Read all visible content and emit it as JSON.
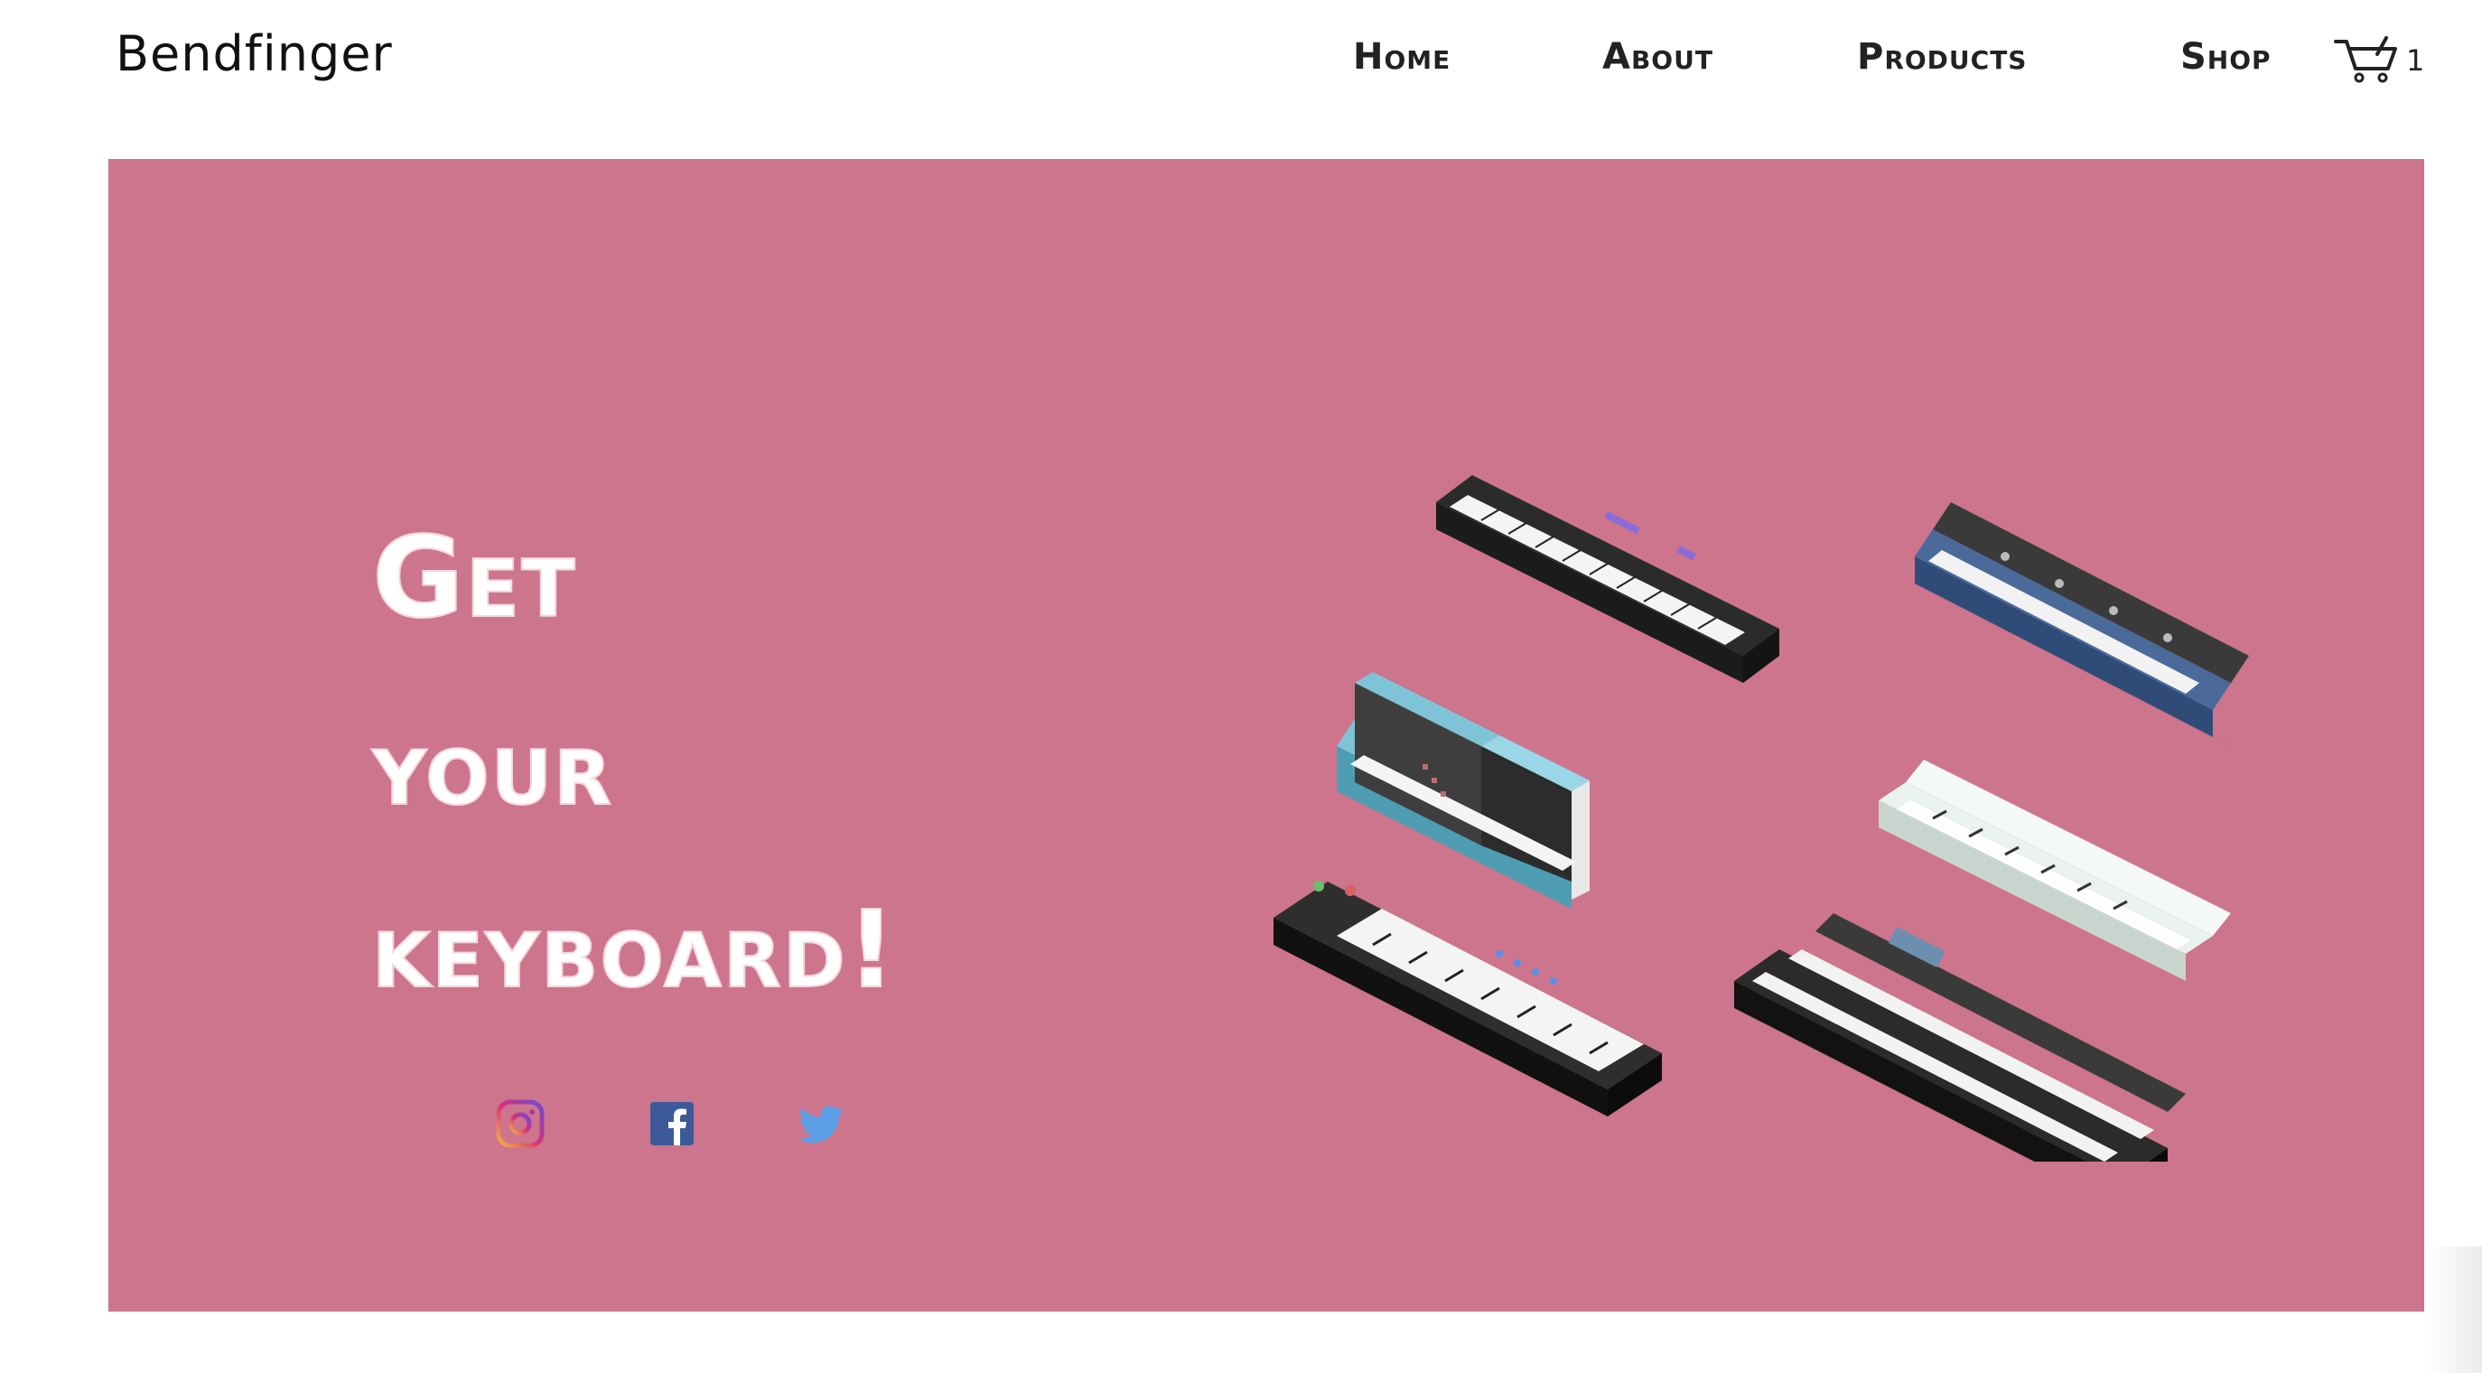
{
  "brand": "Bendfinger",
  "nav": {
    "home": "Home",
    "about": "About",
    "products": "Products",
    "shop": "Shop"
  },
  "cart": {
    "icon": "cart-icon",
    "count": "1"
  },
  "hero": {
    "headline": [
      "Get",
      "your",
      "keyboard!"
    ],
    "background": "#cc758d",
    "social": [
      {
        "name": "instagram-icon"
      },
      {
        "name": "facebook-icon"
      },
      {
        "name": "twitter-icon"
      }
    ]
  },
  "colors": {
    "accent_pink": "#cc758d",
    "text_dark": "#222222",
    "white": "#ffffff"
  }
}
